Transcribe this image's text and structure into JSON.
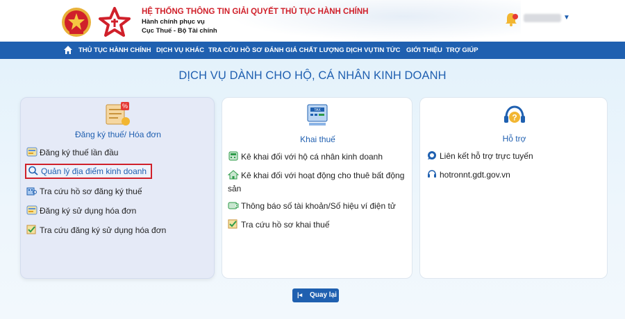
{
  "header": {
    "title": "HỆ THỐNG THÔNG TIN GIẢI QUYẾT THỦ TỤC HÀNH CHÍNH",
    "sub1": "Hành chính phục vụ",
    "sub2": "Cục Thuế - Bộ Tài chính"
  },
  "nav": {
    "items": [
      "THỦ TỤC HÀNH CHÍNH",
      "DỊCH VỤ KHÁC",
      "TRA CỨU HỒ SƠ",
      "ĐÁNH GIÁ CHẤT LƯỢNG DỊCH VỤ",
      "TIN TỨC",
      "GIỚI THIỆU",
      "TRỢ GIÚP"
    ]
  },
  "page": {
    "heading": "DỊCH VỤ DÀNH CHO HỘ, CÁ NHÂN KINH DOANH"
  },
  "cards": [
    {
      "title": "Đăng ký thuế/ Hóa đơn",
      "icon": "tax-registration-icon",
      "items": [
        "Đăng ký thuế lần đầu",
        "Quản lý địa điểm kinh doanh",
        "Tra cứu hồ sơ đăng ký thuế",
        "Đăng ký sử dụng hóa đơn",
        "Tra cứu đăng ký sử dụng hóa đơn"
      ]
    },
    {
      "title": "Khai thuế",
      "icon": "tax-declaration-icon",
      "items": [
        "Kê khai đối với hộ cá nhân kinh doanh",
        "Kê khai đối với hoạt động cho thuê bất động",
        "sản",
        "Thông báo số tài khoản/Số hiệu ví điện tử",
        "Tra cứu hồ sơ khai thuế"
      ]
    },
    {
      "title": "Hỗ trợ",
      "icon": "support-icon",
      "items": [
        "Liên kết hỗ trợ trực tuyến",
        "hotronnt.gdt.gov.vn"
      ]
    }
  ],
  "back_button": {
    "label": "Quay lại"
  },
  "colors": {
    "primary": "#1f60b0",
    "accent_red": "#d0202a",
    "selected_card": "#e5eaf7"
  }
}
